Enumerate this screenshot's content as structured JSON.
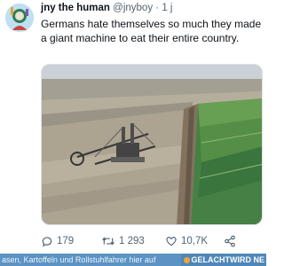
{
  "tweet": {
    "display_name": "jny the human",
    "handle": "@jnyboy",
    "separator": "·",
    "time": "1 j",
    "text": "Germans hate themselves so much they made a giant machine to eat their entire country.",
    "replies": "179",
    "retweets": "1 293",
    "likes": "10,7K"
  },
  "banner": {
    "text": "asen, Kartoffeln und Rollstuhlfahrer hier auf",
    "brand": "GELACHTWIRD NE"
  },
  "colors": {
    "text_primary": "#0f1419",
    "text_secondary": "#536471",
    "banner_bg": "#5a93c4",
    "field_green": "#3d7a3a",
    "mine_sand": "#a89f8c"
  },
  "icons": {
    "avatar": "avatar-graphic",
    "reply": "reply-icon",
    "retweet": "retweet-icon",
    "like": "heart-icon",
    "share": "share-icon"
  }
}
